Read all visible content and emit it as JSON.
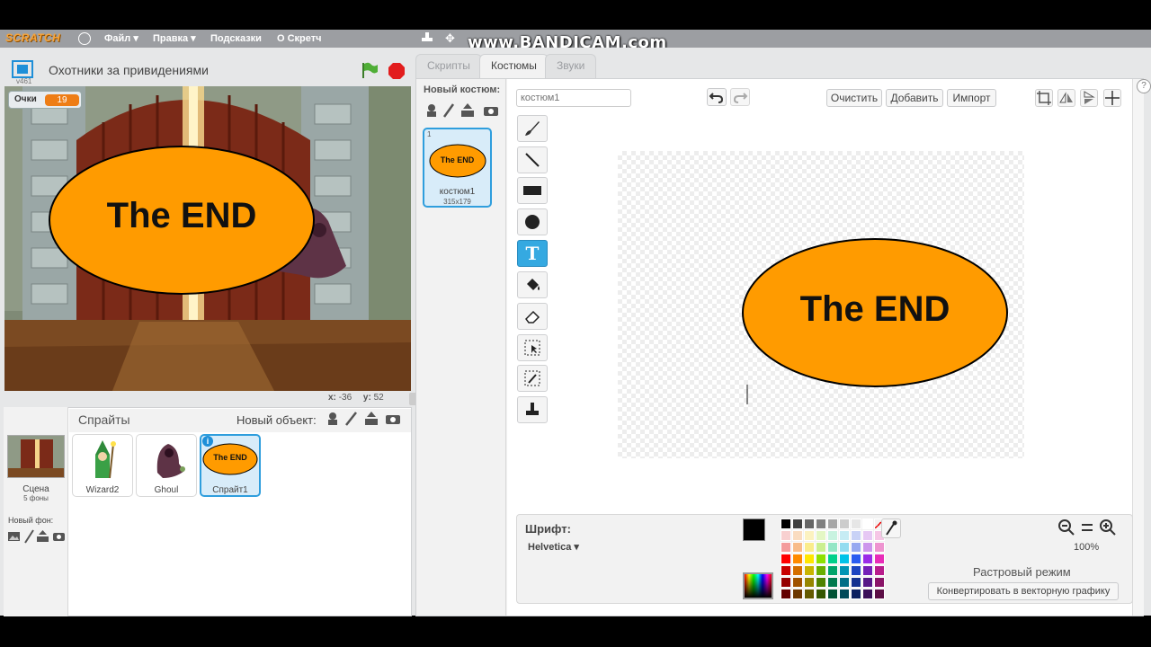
{
  "menu": {
    "logo": "SCRATCH",
    "file": "Файл ▾",
    "edit": "Правка ▾",
    "tips": "Подсказки",
    "about": "О Скретч"
  },
  "watermark": "www.BANDICAM.com",
  "stage": {
    "title": "Охотники за привидениями",
    "version": "v461",
    "score_label": "Очки",
    "score_value": "19",
    "end_text": "The END",
    "coords_x_label": "x:",
    "coords_x": "-36",
    "coords_y_label": "y:",
    "coords_y": "52"
  },
  "sprites": {
    "header": "Спрайты",
    "new_object": "Новый объект:",
    "stage_label": "Сцена",
    "stage_sub": "5 фоны",
    "new_backdrop": "Новый фон:",
    "items": [
      {
        "name": "Wizard2"
      },
      {
        "name": "Ghoul"
      },
      {
        "name": "Спрайт1",
        "thumb_text": "The END"
      }
    ]
  },
  "tabs": [
    "Скрипты",
    "Костюмы",
    "Звуки"
  ],
  "costumes": {
    "new_costume": "Новый костюм:",
    "item": {
      "index": "1",
      "thumb_text": "The END",
      "name": "костюм1",
      "size": "315x179"
    }
  },
  "paint": {
    "costume_name": "костюм1",
    "clear": "Очистить",
    "add": "Добавить",
    "import": "Импорт",
    "canvas_text": "The END",
    "font_label": "Шрифт:",
    "font_value": "Helvetica ▾",
    "zoom": "100%",
    "mode": "Растровый режим",
    "convert": "Конвертировать в векторную графику",
    "palette_rows": [
      [
        "#000000",
        "#404040",
        "#666666",
        "#808080",
        "#a6a6a6",
        "#cccccc",
        "#e6e6e6",
        "#ffffff"
      ],
      [
        "#f8d0d0",
        "#fadcc0",
        "#fcf2c0",
        "#e4f7c4",
        "#c8f3e0",
        "#c6ecf4",
        "#c8d2f6",
        "#e6c8f4",
        "#f6c6e6"
      ],
      [
        "#f49c9c",
        "#f8bc8a",
        "#faec8c",
        "#cbef90",
        "#94e6c6",
        "#92dcf0",
        "#96a8f0",
        "#cc96ec",
        "#ee94d0"
      ],
      [
        "#ff0000",
        "#ff8a00",
        "#ffe600",
        "#8ee000",
        "#00d08a",
        "#00c2e8",
        "#2a5cf0",
        "#9a2ce8",
        "#e82cb8"
      ],
      [
        "#c80000",
        "#d46e00",
        "#c8b400",
        "#6aae00",
        "#00a46a",
        "#0094b4",
        "#1c44c0",
        "#7420b8",
        "#b81c8c"
      ],
      [
        "#960000",
        "#a05200",
        "#968600",
        "#4e8200",
        "#007a4e",
        "#006e86",
        "#143290",
        "#561888",
        "#8a1468"
      ],
      [
        "#640000",
        "#6e3800",
        "#645a00",
        "#345600",
        "#005234",
        "#004a5a",
        "#0c2060",
        "#3a105a",
        "#5c0e46"
      ]
    ],
    "primary_color": "#000000",
    "secondary_color": "#ffffff"
  },
  "colors": {
    "orange": "#ff9b00",
    "accent_blue": "#35a9e1",
    "score_orange": "#ee7d16"
  }
}
